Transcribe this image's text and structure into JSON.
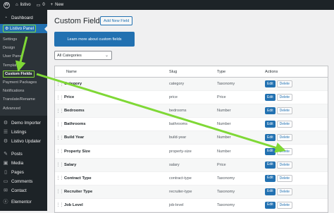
{
  "adminbar": {
    "site": "listivo",
    "comments": "0",
    "new": "New"
  },
  "sidebar": {
    "dashboard": "Dashboard",
    "panel": "Listivo Panel",
    "submenu": [
      "Settings",
      "Design",
      "User Panel",
      "Templates",
      "Custom Fields",
      "Payment Packages",
      "Notifications",
      "Translate/Rename",
      "Advanced"
    ],
    "items": [
      "Demo Importer",
      "Listings",
      "Listivo Updater",
      "Posts",
      "Media",
      "Pages",
      "Comments",
      "Contact",
      "Elementor"
    ]
  },
  "main": {
    "title": "Custom Fields",
    "add_new": "Add New Field",
    "learn_more": "Learn more about custom fields",
    "category_filter": "All Categories"
  },
  "table": {
    "headers": {
      "name": "Name",
      "slug": "Slug",
      "type": "Type",
      "actions": "Actions"
    },
    "edit_label": "Edit",
    "delete_label": "Delete",
    "rows": [
      {
        "name": "Category",
        "slug": "category",
        "type": "Taxonomy"
      },
      {
        "name": "Price",
        "slug": "price",
        "type": "Price"
      },
      {
        "name": "Bedrooms",
        "slug": "bedrooms",
        "type": "Number"
      },
      {
        "name": "Bathrooms",
        "slug": "bathrooms",
        "type": "Number"
      },
      {
        "name": "Build Year",
        "slug": "build-year",
        "type": "Number"
      },
      {
        "name": "Property Size",
        "slug": "property-size",
        "type": "Number"
      },
      {
        "name": "Salary",
        "slug": "salary",
        "type": "Price"
      },
      {
        "name": "Contract Type",
        "slug": "contract-type",
        "type": "Taxonomy"
      },
      {
        "name": "Recruiter Type",
        "slug": "recruiter-type",
        "type": "Taxonomy"
      },
      {
        "name": "Job Level",
        "slug": "job-level",
        "type": "Taxonomy"
      }
    ]
  },
  "colors": {
    "accent": "#2271b1",
    "highlight": "#7fd836",
    "sidebar": "#1d2327"
  }
}
